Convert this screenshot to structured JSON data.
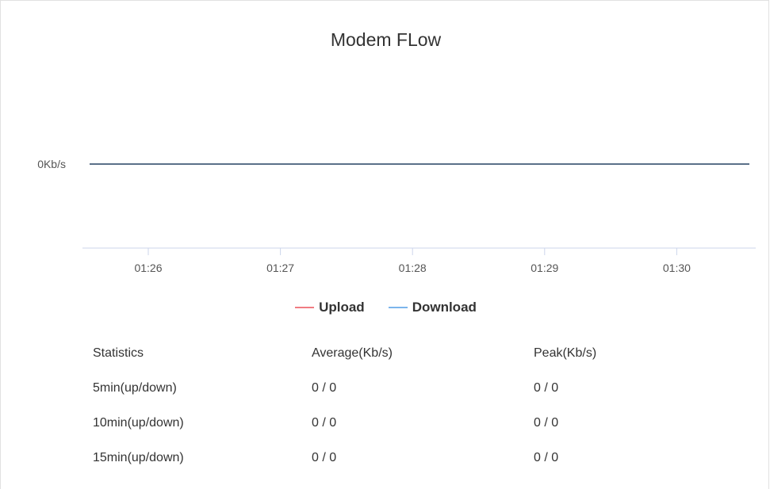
{
  "chart_data": {
    "type": "line",
    "title": "Modem FLow",
    "x": [
      "01:26",
      "01:27",
      "01:28",
      "01:29",
      "01:30"
    ],
    "y_tick_labels": [
      "0Kb/s"
    ],
    "ylabel": "",
    "xlabel": "",
    "series": [
      {
        "name": "Upload",
        "color": "#f07c82",
        "values": [
          0,
          0,
          0,
          0,
          0
        ]
      },
      {
        "name": "Download",
        "color": "#7cb5ec",
        "values": [
          0,
          0,
          0,
          0,
          0
        ]
      }
    ],
    "line_color": "#5b7089",
    "grid": false,
    "legend": "bottom-center"
  },
  "stats": {
    "headers": [
      "Statistics",
      "Average(Kb/s)",
      "Peak(Kb/s)"
    ],
    "rows": [
      [
        "5min(up/down)",
        "0 / 0",
        "0 / 0"
      ],
      [
        "10min(up/down)",
        "0 / 0",
        "0 / 0"
      ],
      [
        "15min(up/down)",
        "0 / 0",
        "0 / 0"
      ]
    ]
  }
}
